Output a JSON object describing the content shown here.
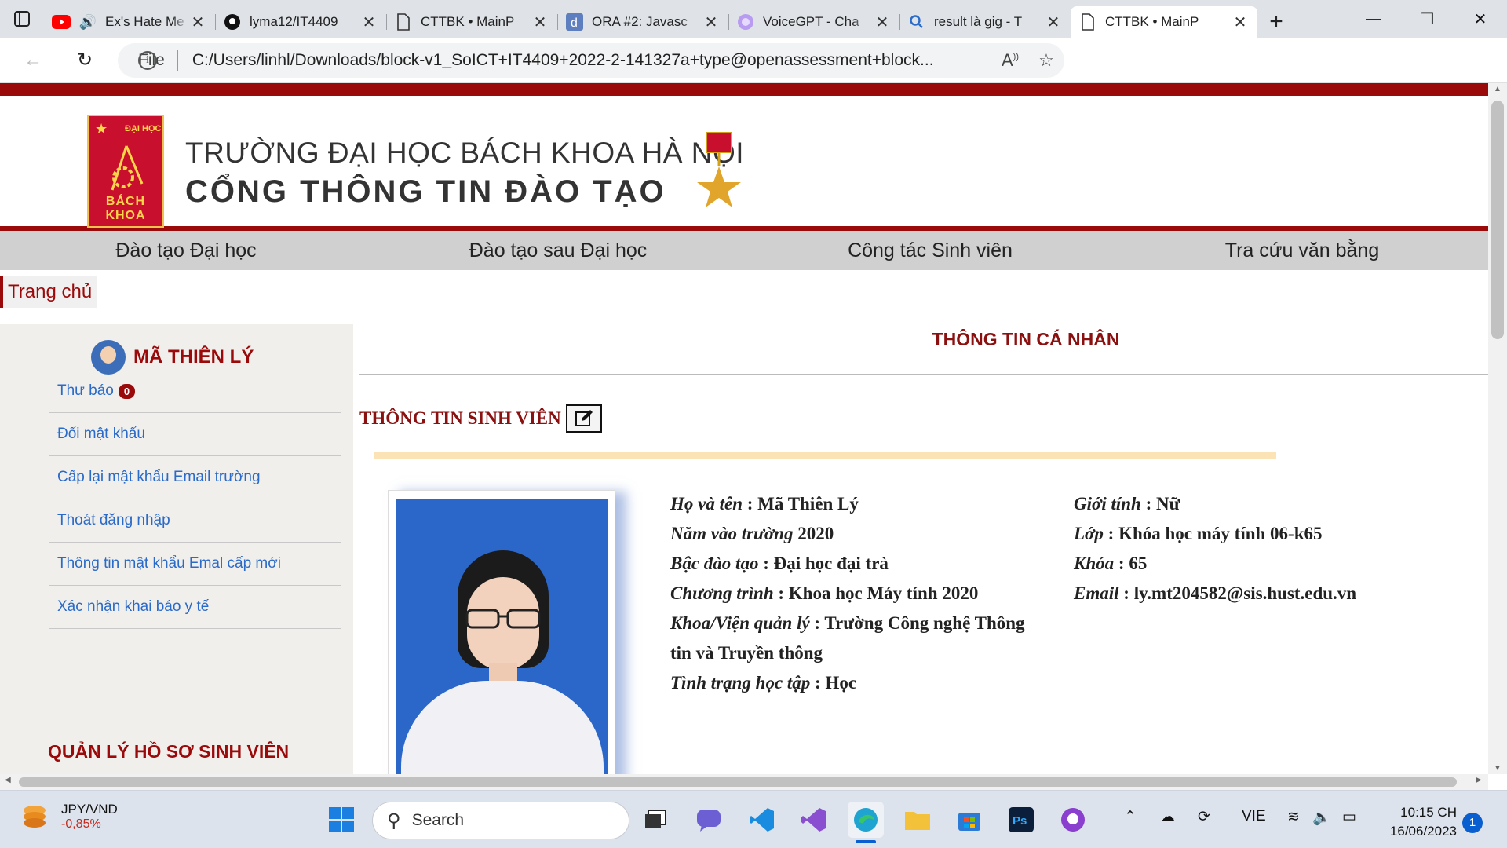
{
  "browser": {
    "tabs": [
      {
        "title": "Ex's Hate Me",
        "icon": "youtube-icon"
      },
      {
        "title": "lyma12/IT4409",
        "icon": "github-icon"
      },
      {
        "title": "CTTBK • MainP",
        "icon": "document-icon"
      },
      {
        "title": "ORA #2: Javasc",
        "icon": "d-icon"
      },
      {
        "title": "VoiceGPT - Cha",
        "icon": "voicegpt-icon"
      },
      {
        "title": "result là gig - T",
        "icon": "search-icon"
      },
      {
        "title": "CTTBK • MainP",
        "icon": "document-icon",
        "active": true
      }
    ],
    "address": {
      "scheme": "File",
      "url": "C:/Users/linhl/Downloads/block-v1_SoICT+IT4409+2022-2-141327a+type@openassessment+block..."
    }
  },
  "page": {
    "school_name": "TRƯỜNG ĐẠI HỌC BÁCH KHOA HÀ NỘI",
    "portal_name": "CỔNG THÔNG TIN ĐÀO TẠO",
    "logo_text_top": "ĐẠI HỌC",
    "logo_text_bottom": "BÁCH KHOA",
    "menu": [
      "Đào tạo Đại học",
      "Đào tạo sau Đại học",
      "Công tác Sinh viên",
      "Tra cứu văn bằng"
    ],
    "breadcrumb": "Trang chủ",
    "sidebar": {
      "user_name": "MÃ THIÊN LÝ",
      "links": [
        {
          "label": "Thư báo",
          "badge": "0"
        },
        {
          "label": "Đổi mật khẩu"
        },
        {
          "label": "Cấp lại mật khẩu Email trường"
        },
        {
          "label": "Thoát đăng nhập"
        },
        {
          "label": "Thông tin mật khẩu Emal cấp mới"
        },
        {
          "label": "Xác nhận khai báo y tế"
        }
      ],
      "section_title": "QUẢN LÝ HỒ SƠ SINH VIÊN"
    },
    "main_title": "THÔNG TIN CÁ NHÂN",
    "student_heading": "THÔNG TIN SINH VIÊN",
    "student": {
      "left": [
        {
          "label": "Họ và tên",
          "sep": " : ",
          "value": "Mã Thiên Lý"
        },
        {
          "label": "Năm vào trường",
          "sep": " ",
          "value": "2020"
        },
        {
          "label": "Bậc đào tạo",
          "sep": " : ",
          "value": "Đại học đại trà"
        },
        {
          "label": "Chương trình",
          "sep": " : ",
          "value": "Khoa học Máy tính 2020"
        },
        {
          "label": "Khoa/Viện quản lý",
          "sep": " : ",
          "value": "Trường Công nghệ Thông tin và Truyền thông"
        },
        {
          "label": "Tình trạng học tập",
          "sep": " : ",
          "value": "Học"
        }
      ],
      "right": [
        {
          "label": "Giới tính",
          "sep": " : ",
          "value": "Nữ"
        },
        {
          "label": "Lớp",
          "sep": " : ",
          "value": "Khóa học máy tính 06-k65"
        },
        {
          "label": "Khóa",
          "sep": " : ",
          "value": "65"
        },
        {
          "label": "Email",
          "sep": " : ",
          "value": "ly.mt204582@sis.hust.edu.vn"
        }
      ]
    }
  },
  "taskbar": {
    "ticker_symbol": "JPY/VND",
    "ticker_change": "-0,85%",
    "search_placeholder": "Search",
    "language": "VIE",
    "time": "10:15 CH",
    "date": "16/06/2023",
    "notifications": "1"
  },
  "colors": {
    "brand_red": "#9b0a0a",
    "link_blue": "#2a6ac8",
    "gold": "#fbe3b6"
  }
}
